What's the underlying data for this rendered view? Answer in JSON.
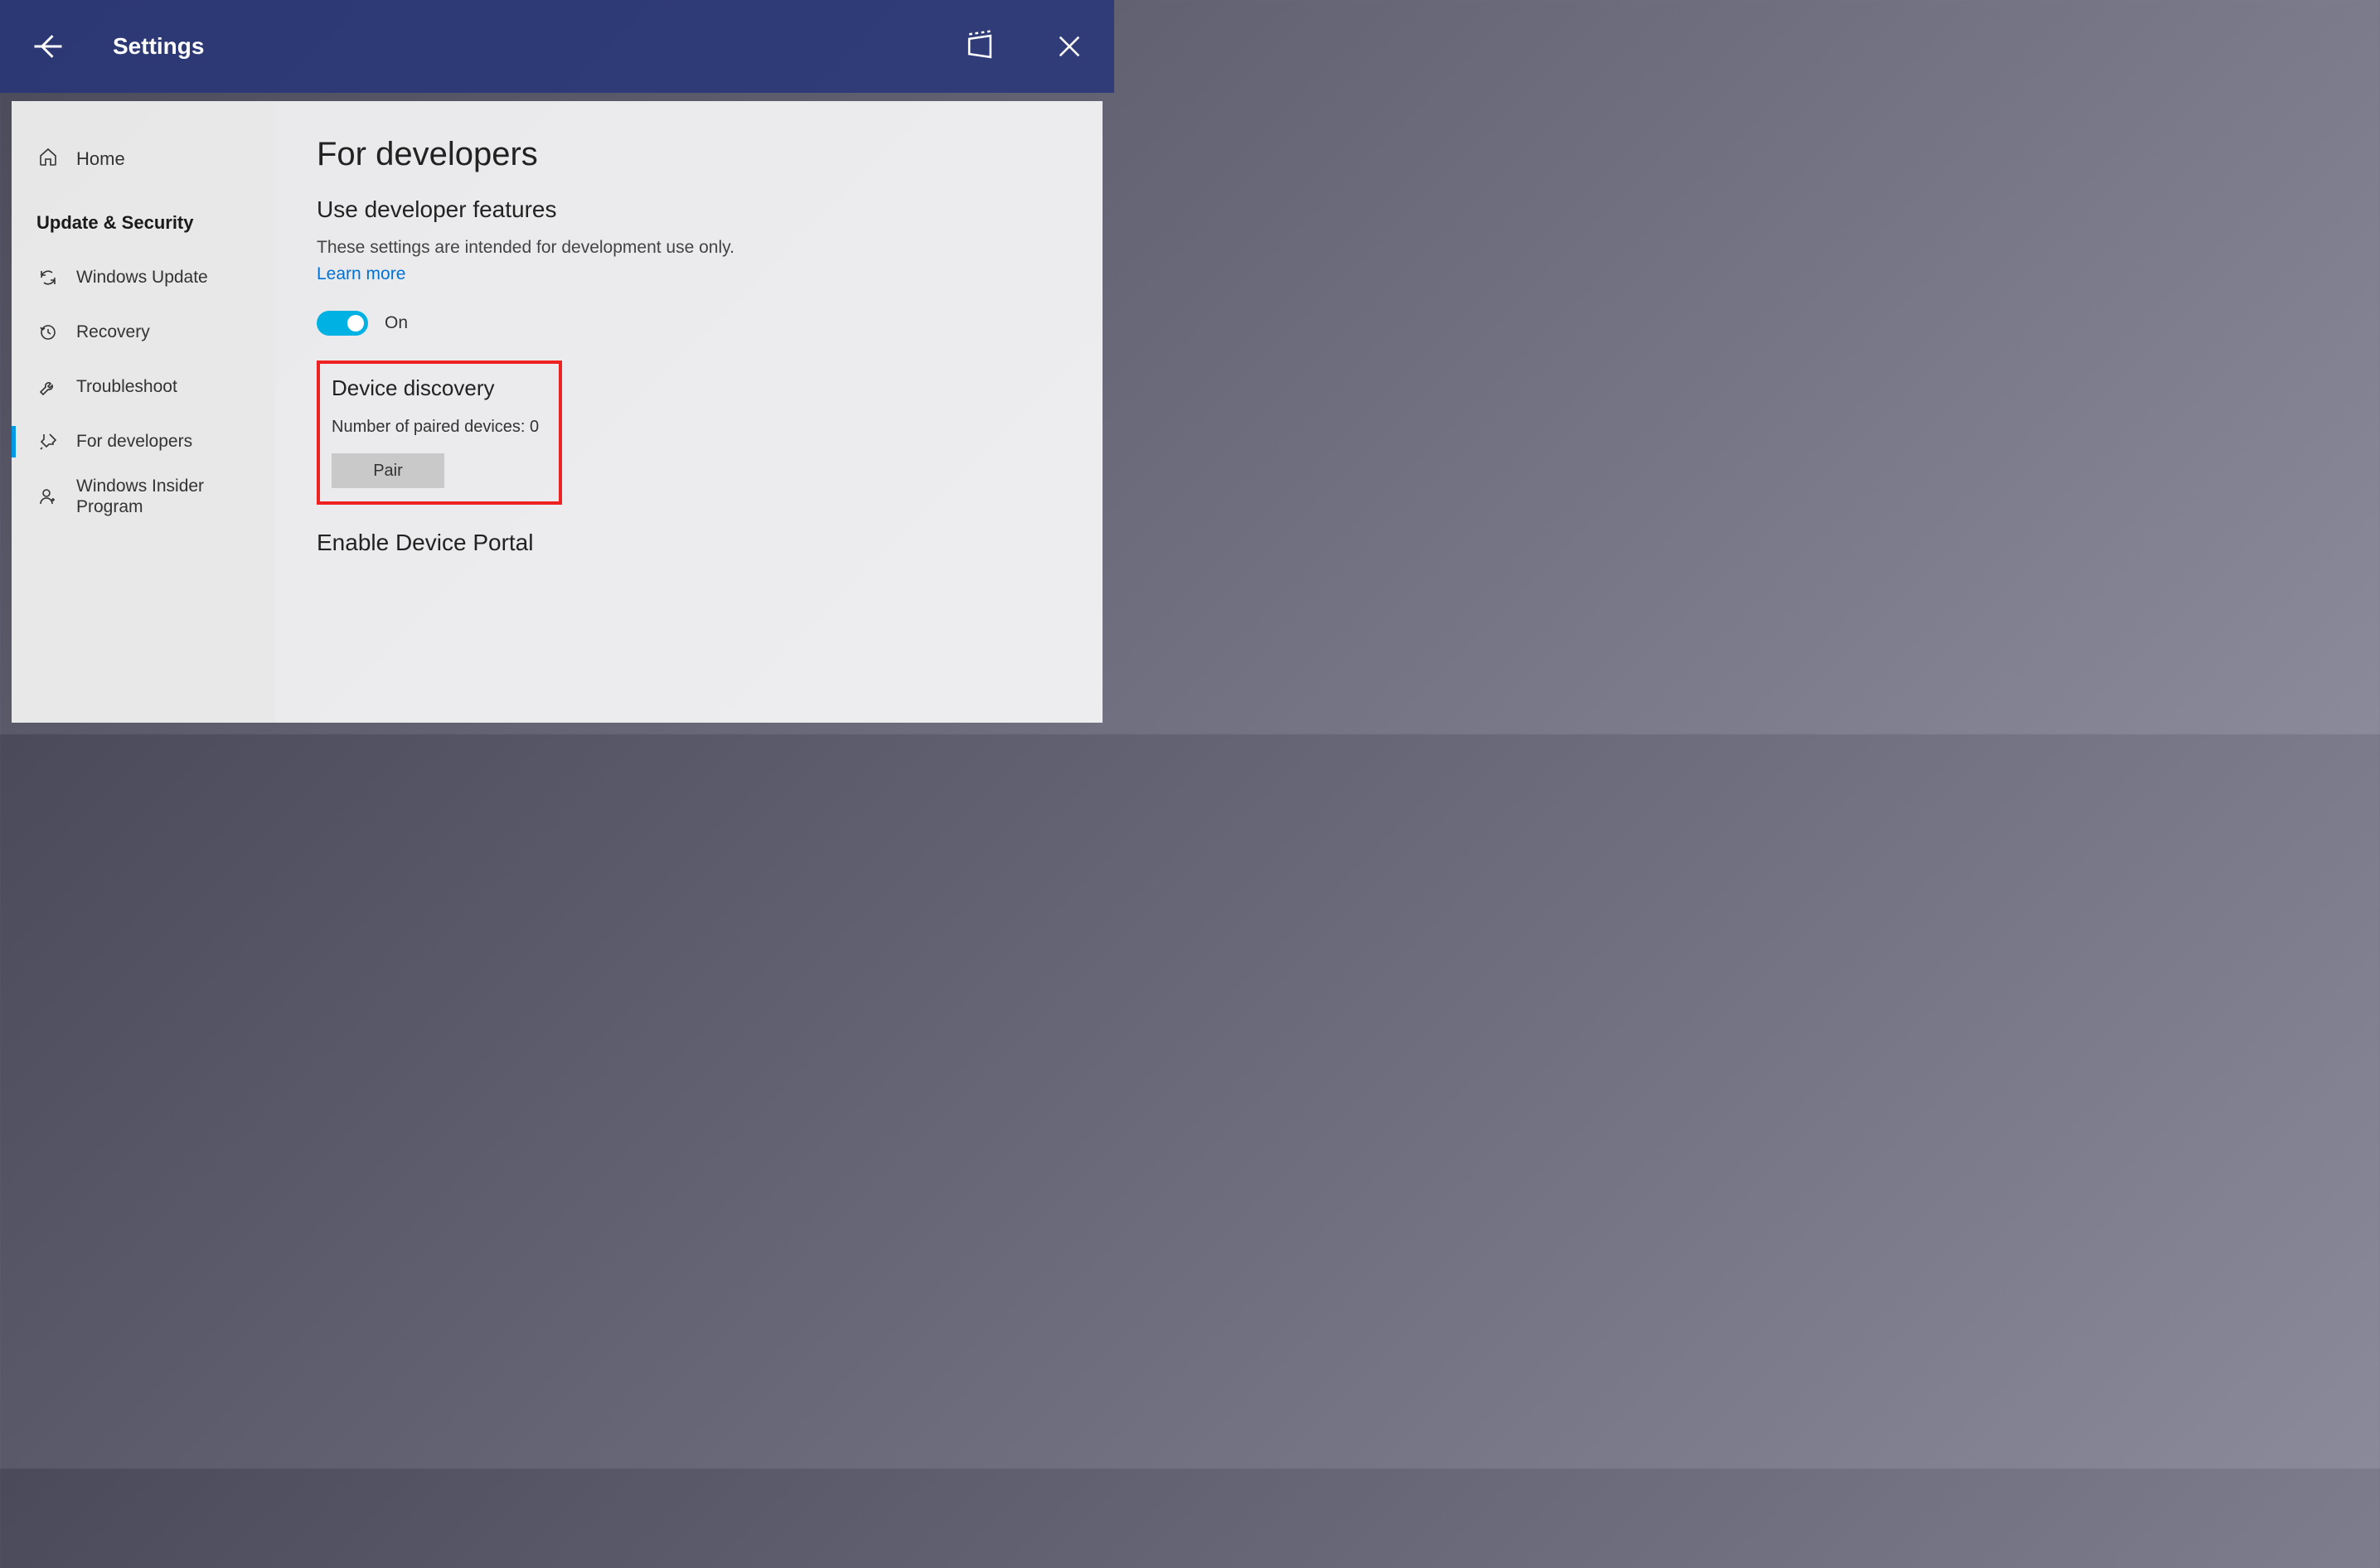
{
  "titlebar": {
    "title": "Settings"
  },
  "sidebar": {
    "home_label": "Home",
    "group_label": "Update & Security",
    "items": [
      {
        "label": "Windows Update"
      },
      {
        "label": "Recovery"
      },
      {
        "label": "Troubleshoot"
      },
      {
        "label": "For developers"
      },
      {
        "label": "Windows Insider Program"
      }
    ]
  },
  "content": {
    "page_title": "For developers",
    "dev_features_heading": "Use developer features",
    "dev_features_desc": "These settings are intended for development use only.",
    "learn_more": "Learn more",
    "toggle_state": "On",
    "device_discovery": {
      "heading": "Device discovery",
      "paired_label": "Number of paired devices: 0",
      "pair_button": "Pair"
    },
    "enable_portal_heading": "Enable Device Portal"
  }
}
